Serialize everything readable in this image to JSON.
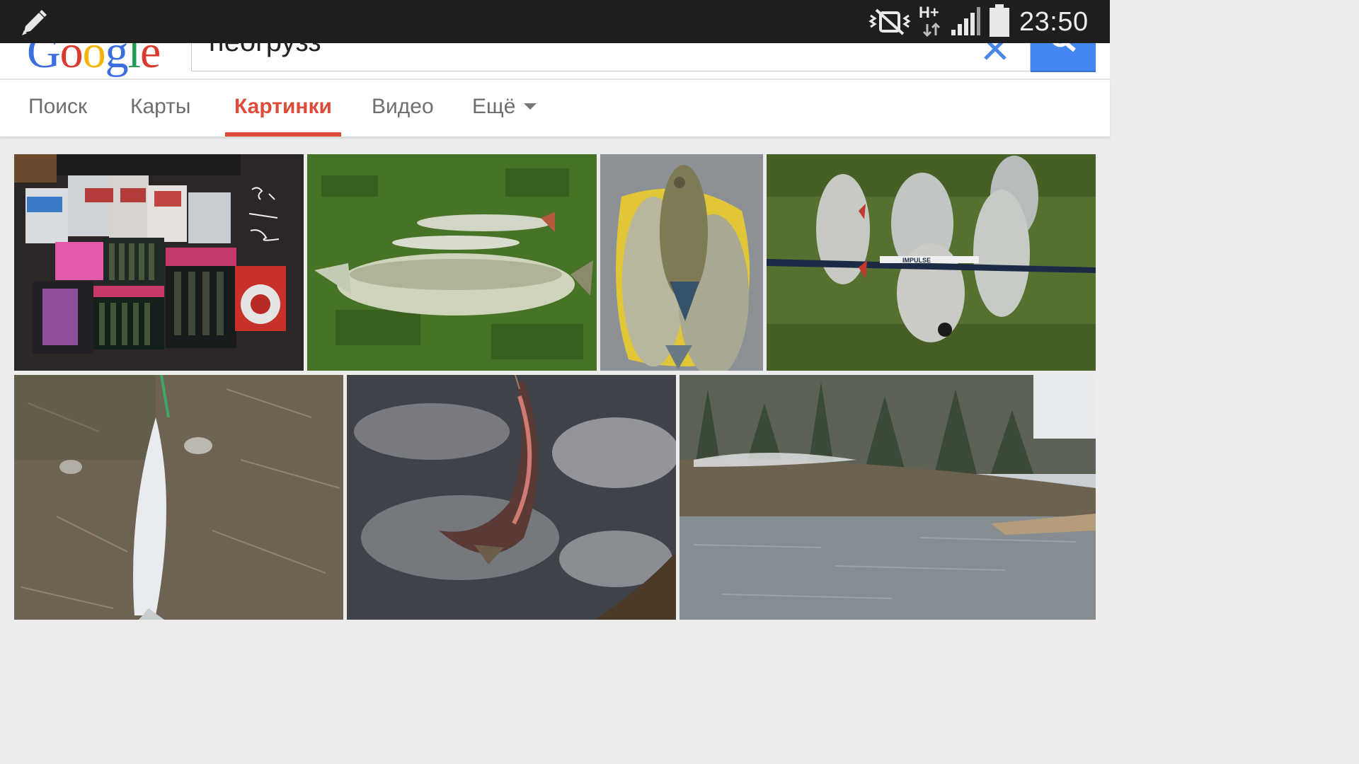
{
  "status_bar": {
    "network_type": "H+",
    "time": "23:50",
    "icons": [
      "pencil-icon",
      "mute-icon",
      "network-icon",
      "signal-icon",
      "battery-icon"
    ]
  },
  "header": {
    "logo_text": "Google",
    "search_query": "пеогрузз",
    "clear_icon": "close-icon",
    "search_icon": "search-icon"
  },
  "tabs": [
    {
      "label": "Поиск",
      "active": false
    },
    {
      "label": "Карты",
      "active": false
    },
    {
      "label": "Картинки",
      "active": true
    },
    {
      "label": "Видео",
      "active": false
    },
    {
      "label": "Ещё",
      "active": false,
      "dropdown": true
    }
  ],
  "colors": {
    "active_tab": "#dd4b39",
    "search_button": "#4486f2",
    "status_bar": "#1e1e1e"
  },
  "results": [
    {
      "description": "fishing lures in packages",
      "watermark": ""
    },
    {
      "description": "pike on grass"
    },
    {
      "description": "tench and crucian in yellow bag"
    },
    {
      "description": "roach with fishing rod",
      "rod_label": "IMPULSE"
    },
    {
      "description": "pike on dry grass"
    },
    {
      "description": "pike hanging over water"
    },
    {
      "description": "river with forest"
    }
  ]
}
